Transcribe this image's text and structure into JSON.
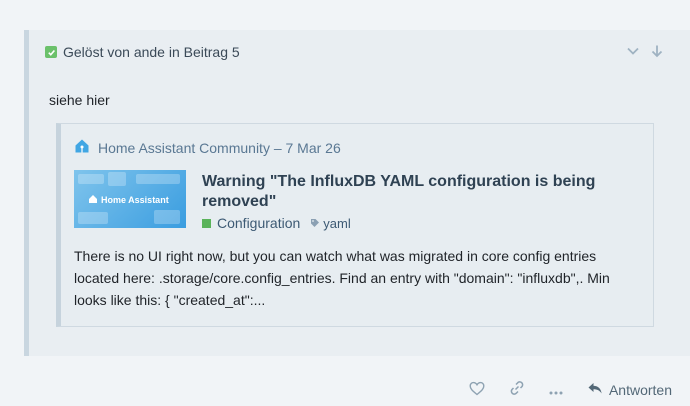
{
  "quote": {
    "title": "Gelöst von ande in Beitrag 5",
    "controls": [
      "chevron-down-icon",
      "arrow-down-icon"
    ]
  },
  "post": {
    "text": "siehe hier"
  },
  "onebox": {
    "source": "Home Assistant Community – 7 Mar 26",
    "thumbnail_text": "Home Assistant",
    "title": "Warning \"The InfluxDB YAML configuration is being removed\"",
    "category": "Configuration",
    "category_color": "#5ab35a",
    "tag": "yaml",
    "excerpt": "There is no UI right now, but you can watch what was migrated in core config entries located here: .storage/core.config_entries. Find an entry with \"domain\": \"influxdb\",. Min looks like this: { \"created_at\":..."
  },
  "actions": {
    "reply_label": "Antworten",
    "icons": [
      "heart-icon",
      "link-icon",
      "more-icon",
      "reply-icon"
    ]
  }
}
